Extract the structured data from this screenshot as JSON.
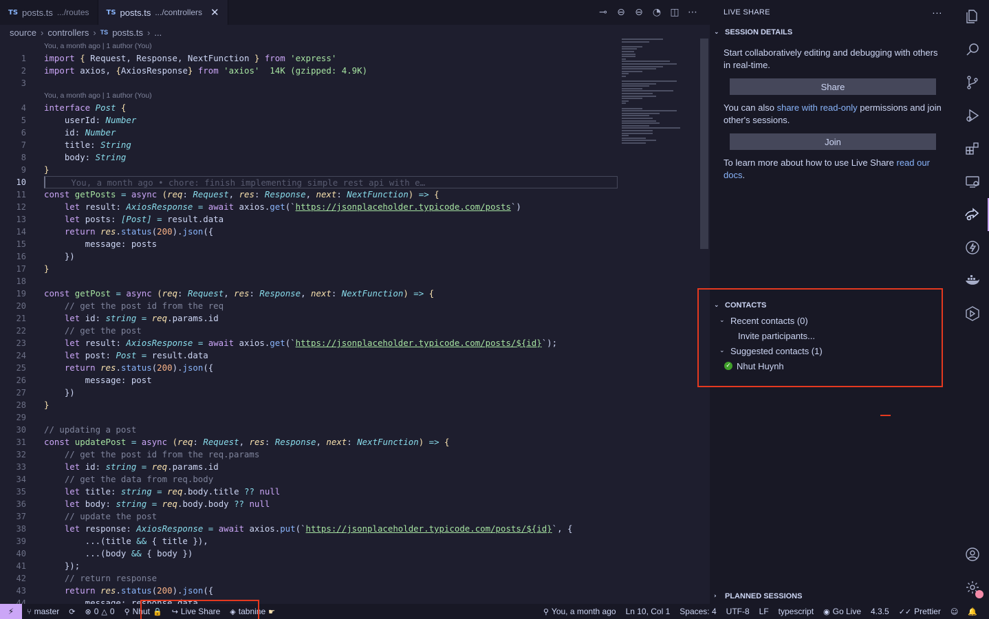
{
  "tabs": [
    {
      "icon": "TS",
      "name": "posts.ts",
      "path": ".../routes",
      "active": false
    },
    {
      "icon": "TS",
      "name": "posts.ts",
      "path": ".../controllers",
      "active": true,
      "close": "✕"
    }
  ],
  "breadcrumb": {
    "items": [
      "source",
      "controllers",
      "posts.ts",
      "..."
    ],
    "ts_icon": "TS"
  },
  "codelens": [
    "You, a month ago | 1 author (You)",
    "You, a month ago | 1 author (You)"
  ],
  "import_size": "14K (gzipped: 4.9K)",
  "blame": "You, a month ago • chore: finish implementing simple rest api with e…",
  "line_numbers": [
    "1",
    "2",
    "3",
    "4",
    "5",
    "6",
    "7",
    "8",
    "9",
    "10",
    "11",
    "12",
    "13",
    "14",
    "15",
    "16",
    "17",
    "18",
    "19",
    "20",
    "21",
    "22",
    "23",
    "24",
    "25",
    "26",
    "27",
    "28",
    "29",
    "30",
    "31",
    "32",
    "33",
    "34",
    "35",
    "36",
    "37",
    "38",
    "39",
    "40",
    "41",
    "42",
    "43",
    "44"
  ],
  "strings": {
    "express": "'express'",
    "axios": "'axios'",
    "url_posts": "https://jsonplaceholder.typicode.com/posts",
    "url_post": "https://jsonplaceholder.typicode.com/posts/",
    "cm_get_id": "// get the post id from the req",
    "cm_get_post": "// get the post",
    "cm_updating": "// updating a post",
    "cm_get_id_params": "// get the post id from the req.params",
    "cm_get_data": "// get the data from req.body",
    "cm_update": "// update the post",
    "cm_return": "// return response"
  },
  "sidebar": {
    "title": "LIVE SHARE",
    "more": "···",
    "session": {
      "header": "SESSION DETAILS",
      "intro": "Start collaboratively editing and debugging with others in real-time.",
      "share_button": "Share",
      "also_pre": "You can also ",
      "also_link": "share with read-only",
      "also_post": " permissions and join other's sessions.",
      "join_button": "Join",
      "learn_pre": "To learn more about how to use Live Share ",
      "learn_link": "read our docs",
      "learn_post": "."
    },
    "contacts": {
      "header": "CONTACTS",
      "recent": "Recent contacts (0)",
      "invite": "Invite participants...",
      "suggested": "Suggested contacts (1)",
      "person": "Nhut Huynh"
    },
    "planned": "PLANNED SESSIONS"
  },
  "activity_icons": [
    "explorer-icon",
    "search-icon",
    "source-control-icon",
    "run-debug-icon",
    "extensions-icon",
    "remote-explorer-icon",
    "live-share-icon",
    "thunder-client-icon",
    "docker-icon",
    "gitlens-icon",
    "account-icon",
    "settings-gear-icon"
  ],
  "statusbar": {
    "branch": "master",
    "errors": "0",
    "warnings": "0",
    "user": "Nhut",
    "live_share": "Live Share",
    "tabnine": "tabnine",
    "blame": "You, a month ago",
    "position": "Ln 10, Col 1",
    "spaces": "Spaces: 4",
    "encoding": "UTF-8",
    "eol": "LF",
    "language": "typescript",
    "go_live": "Go Live",
    "version": "4.3.5",
    "prettier": "Prettier"
  },
  "colors": {
    "accent": "#cba6f7",
    "highlight": "#e5391f",
    "online": "#40a02b"
  }
}
